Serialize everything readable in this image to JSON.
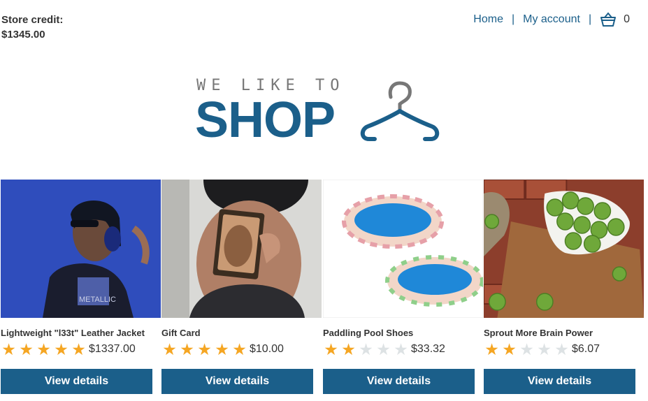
{
  "header": {
    "store_credit_label": "Store credit:",
    "store_credit_value": "$1345.00",
    "nav": {
      "home": "Home",
      "separator": "|",
      "my_account": "My account",
      "cart_count": "0"
    }
  },
  "logo": {
    "tagline": "WE LIKE TO",
    "word": "SHOP"
  },
  "colors": {
    "brand": "#1b5f8a",
    "star": "#f5a623",
    "star_empty": "#dde2e4"
  },
  "products": [
    {
      "name": "Lightweight \"l33t\" Leather Jacket",
      "rating": 5,
      "price": "$1337.00",
      "button": "View details",
      "image_icon": "person-headphones-image"
    },
    {
      "name": "Gift Card",
      "rating": 5,
      "price": "$10.00",
      "button": "View details",
      "image_icon": "card-held-image"
    },
    {
      "name": "Paddling Pool Shoes",
      "rating": 2,
      "price": "$33.32",
      "button": "View details",
      "image_icon": "paddling-pools-image"
    },
    {
      "name": "Sprout More Brain Power",
      "rating": 2,
      "price": "$6.07",
      "button": "View details",
      "image_icon": "brussels-sprouts-image"
    }
  ]
}
